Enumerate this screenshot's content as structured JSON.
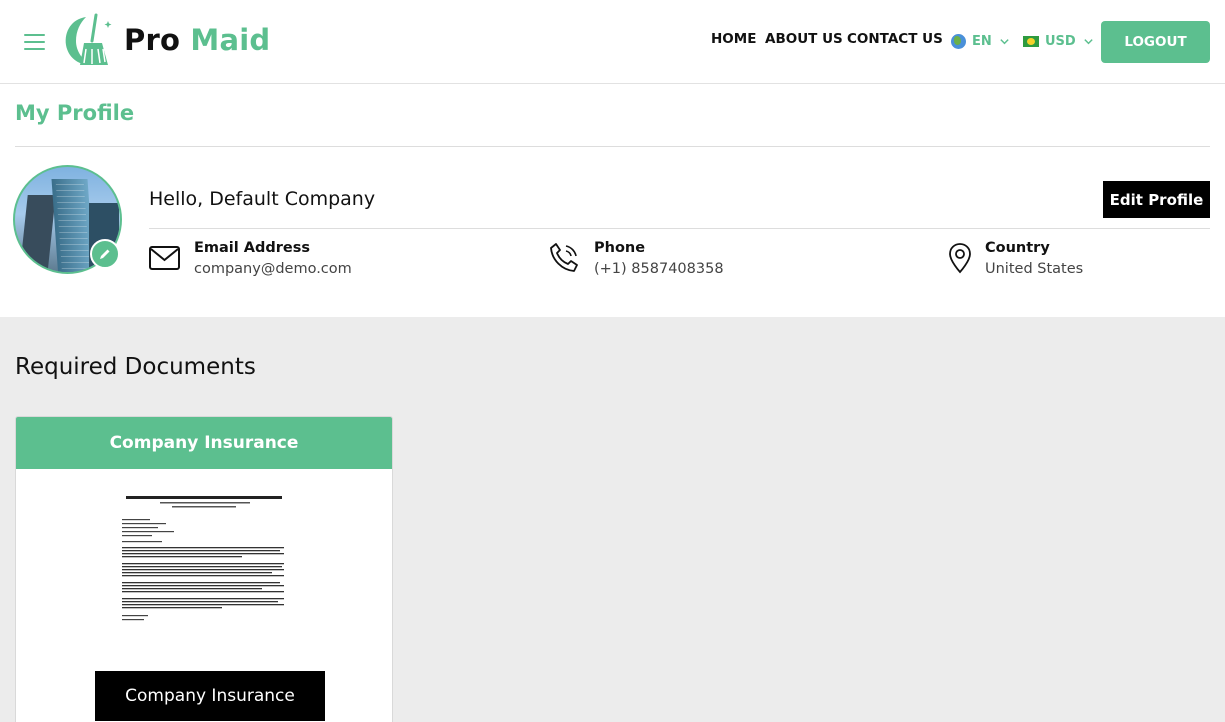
{
  "header": {
    "logo": {
      "word1": "Pro",
      "word2": "Maid"
    },
    "nav": [
      {
        "label": "HOME"
      },
      {
        "label": "ABOUT US"
      },
      {
        "label": "CONTACT US"
      }
    ],
    "language": {
      "value": "EN",
      "icon": "globe-icon"
    },
    "currency": {
      "value": "USD",
      "icon": "flag-icon"
    },
    "logout_label": "LOGOUT"
  },
  "profile": {
    "section_title": "My Profile",
    "greeting": "Hello, Default Company",
    "edit_label": "Edit Profile",
    "email": {
      "label": "Email Address",
      "value": "company@demo.com"
    },
    "phone": {
      "label": "Phone",
      "value": "(+1) 8587408358"
    },
    "country": {
      "label": "Country",
      "value": "United States"
    }
  },
  "documents": {
    "section_title": "Required Documents",
    "items": [
      {
        "title": "Company Insurance",
        "button_label": "Company Insurance"
      }
    ]
  },
  "colors": {
    "brand_green": "#5cbf8f",
    "dark_button": "#000000",
    "page_background": "#ececec"
  }
}
